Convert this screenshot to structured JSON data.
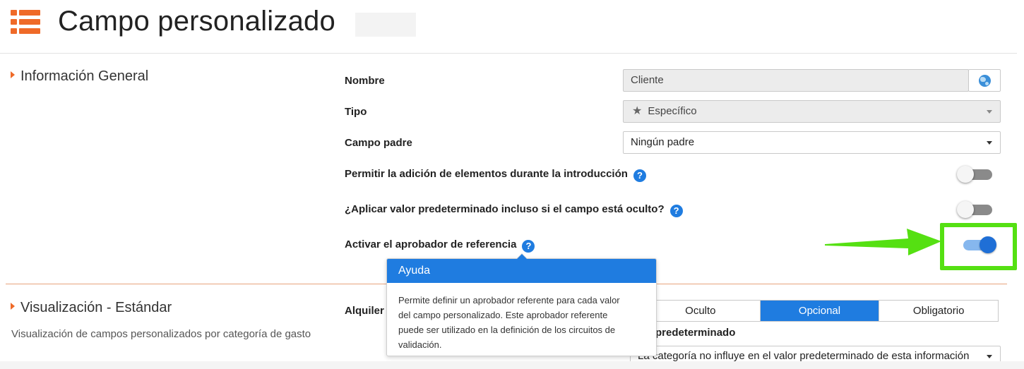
{
  "header": {
    "title": "Campo personalizado",
    "menu_icon": "list-menu-icon",
    "accent_color": "#ef6a28"
  },
  "general": {
    "section_title": "Información General",
    "fields": {
      "nombre": {
        "label": "Nombre",
        "value": "Cliente",
        "icon": "globe-icon"
      },
      "tipo": {
        "label": "Tipo",
        "value": "Específico",
        "icon": "star-icon"
      },
      "campo_padre": {
        "label": "Campo padre",
        "value": "Ningún padre"
      }
    },
    "toggles": [
      {
        "label": "Permitir la adición de elementos durante la introducción",
        "on": false
      },
      {
        "label": "¿Aplicar valor predeterminado incluso si el campo está oculto?",
        "on": false
      },
      {
        "label": "Activar el aprobador de referencia",
        "on": true
      }
    ],
    "help_glyph": "?"
  },
  "tooltip": {
    "title": "Ayuda",
    "lines": [
      "Permite definir un aprobador referente para cada valor",
      "del campo personalizado. Este aprobador referente",
      "puede ser utilizado en la definición de los circuitos de",
      "validación."
    ]
  },
  "visualizacion": {
    "section_title": "Visualización - Estándar",
    "subtitle": "Visualización de campos personalizados por categoría de gasto",
    "row_label": "Alquiler",
    "segments": [
      "Oculto",
      "Opcional",
      "Obligatorio"
    ],
    "selected_segment": "Opcional",
    "default_label": "predeterminado",
    "default_value": "La categoría no influye en el valor predeterminado de esta información"
  },
  "colors": {
    "primary_blue": "#1f7ce0",
    "highlight_green": "#55e012",
    "divider": "#e8a47c"
  }
}
